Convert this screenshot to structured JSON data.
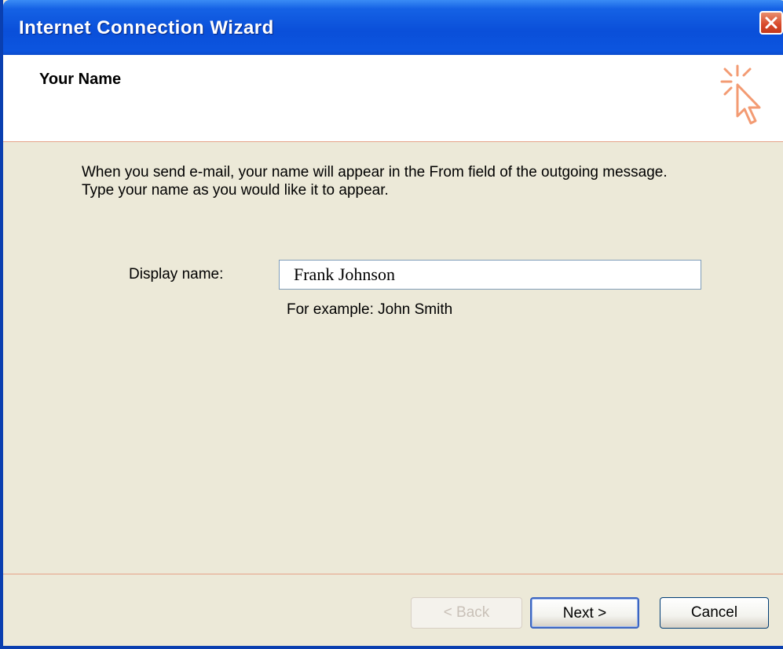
{
  "window": {
    "title": "Internet Connection Wizard"
  },
  "header": {
    "title": "Your Name"
  },
  "intro": {
    "line1": "When you send e-mail, your name will appear in the From field of the outgoing message.",
    "line2": "Type your name as you would like it to appear."
  },
  "form": {
    "display_name_label": "Display name:",
    "display_name_value": "Frank Johnson",
    "example_text": "For example: John Smith"
  },
  "buttons": {
    "back_label": "< Back",
    "next_label": "Next >",
    "cancel_label": "Cancel"
  },
  "icons": {
    "close": "close-icon",
    "wizard": "wizard-cursor-icon"
  },
  "colors": {
    "titlebar": "#0a4fd9",
    "close_button": "#d8492a",
    "dialog_background": "#ece9d8",
    "separator": "#e6a38a"
  }
}
